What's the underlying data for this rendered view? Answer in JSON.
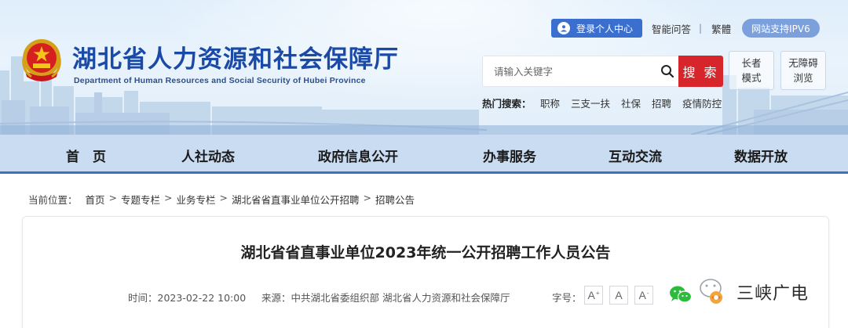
{
  "header": {
    "title_cn": "湖北省人力资源和社会保障厅",
    "title_en": "Department of Human Resources and Social Security of Hubei Province",
    "login_label": "登录个人中心",
    "links": [
      "智能问答",
      "繁體"
    ],
    "separator": "|",
    "ipv6_label": "网站支持IPV6",
    "search_placeholder": "请输入关键字",
    "search_button": "搜 索",
    "elder_mode": [
      "长者",
      "模式"
    ],
    "accessible_browse": [
      "无障碍",
      "浏览"
    ],
    "hot_label": "热门搜索：",
    "hot_words": [
      "职称",
      "三支一扶",
      "社保",
      "招聘",
      "疫情防控"
    ]
  },
  "nav": {
    "items": [
      "首　页",
      "人社动态",
      "政府信息公开",
      "办事服务",
      "互动交流",
      "数据开放"
    ]
  },
  "breadcrumb": {
    "label": "当前位置：",
    "items": [
      "首页",
      "专题专栏",
      "业务专栏",
      "湖北省省直事业单位公开招聘",
      "招聘公告"
    ],
    "separator": ">"
  },
  "article": {
    "title": "湖北省省直事业单位2023年统一公开招聘工作人员公告",
    "time": "时间：2023-02-22 10:00",
    "source": "来源：中共湖北省委组织部 湖北省人力资源和社会保障厅",
    "font_size_label": "字号：",
    "font_buttons": [
      "A",
      "A",
      "A"
    ],
    "font_button_marks": [
      "+",
      "",
      "-"
    ]
  },
  "watermark": {
    "text": "三峡广电"
  },
  "colors": {
    "primary_blue": "#1b4aa6",
    "login_blue": "#3a6fd0",
    "search_red": "#d7262b",
    "nav_bg": "#c9dcf2",
    "nav_border": "#3e6fc2"
  }
}
